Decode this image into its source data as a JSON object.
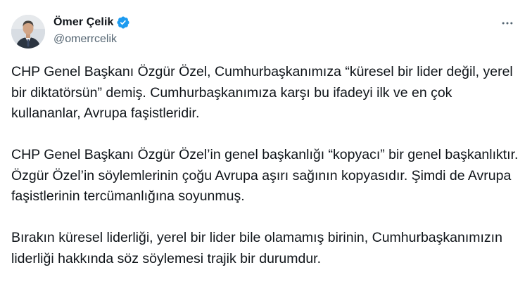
{
  "author": {
    "display_name": "Ömer Çelik",
    "handle": "@omerrcelik",
    "verified": true,
    "verified_color": "#1d9bf0"
  },
  "icons": {
    "verified": "verified-badge-icon",
    "more": "more-options-icon"
  },
  "tweet": {
    "paragraphs": [
      "CHP Genel Başkanı Özgür Özel, Cumhurbaşkanımıza “küresel bir lider değil, yerel bir diktatörsün” demiş. Cumhurbaşkanımıza karşı bu ifadeyi ilk ve en çok kullananlar, Avrupa faşistleridir.",
      "CHP Genel Başkanı Özgür Özel’in genel başkanlığı “kopyacı” bir genel başkanlıktır. Özgür Özel’in söylemlerinin çoğu Avrupa aşırı sağının kopyasıdır. Şimdi de Avrupa faşistlerinin tercümanlığına soyunmuş.",
      "Bırakın küresel liderliği, yerel bir lider bile olamamış birinin, Cumhurbaşkanımızın liderliği hakkında söz söylemesi trajik bir durumdur."
    ]
  }
}
